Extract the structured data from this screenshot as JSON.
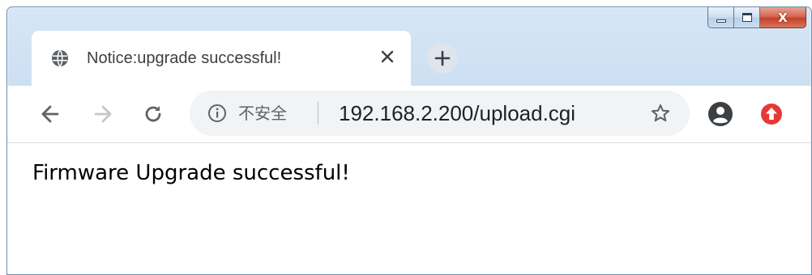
{
  "window": {
    "buttons": [
      "minimize",
      "maximize",
      "close"
    ],
    "close_glyph": "X"
  },
  "tab": {
    "title": "Notice:upgrade successful!",
    "favicon": "globe-icon",
    "close_glyph": "×",
    "new_tab_glyph": "+"
  },
  "toolbar": {
    "back_icon": "arrow-left-icon",
    "forward_icon": "arrow-right-icon",
    "reload_icon": "reload-icon",
    "security_label": "不安全",
    "url": "192.168.2.200/upload.cgi",
    "bookmark_icon": "star-icon",
    "profile_icon": "account-icon",
    "extension_icon": "upgrade-arrow-icon",
    "extension_color": "#e53935"
  },
  "page": {
    "message": "Firmware Upgrade successful!"
  },
  "colors": {
    "frame": "#c3d8ee",
    "omnibox": "#f1f3f4",
    "close_button": "#c2412a"
  }
}
